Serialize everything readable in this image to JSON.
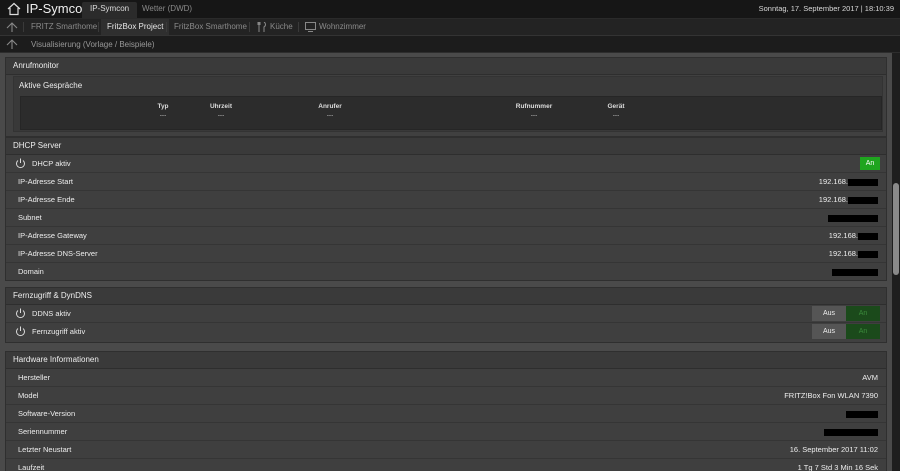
{
  "header": {
    "brand": "IP-Symcon",
    "tabs": [
      {
        "label": "IP-Symcon",
        "active": true
      },
      {
        "label": "Wetter (DWD)",
        "active": false
      }
    ],
    "datetime": "Sonntag, 17. September 2017 | 18:10:39"
  },
  "nav": {
    "items": [
      {
        "label": "FRITZ Smarthome",
        "active": false
      },
      {
        "label": "FritzBox Project",
        "active": true
      },
      {
        "label": "FritzBox Smarthome",
        "active": false
      },
      {
        "label": "Küche",
        "active": false
      },
      {
        "label": "Wohnzimmer",
        "active": false
      }
    ]
  },
  "subnav": {
    "label": "Visualisierung (Vorlage / Beispiele)"
  },
  "anrufmonitor": {
    "title": "Anrufmonitor",
    "subtitle": "Aktive Gespräche",
    "columns": [
      {
        "header": "Typ",
        "value": "---"
      },
      {
        "header": "Uhrzeit",
        "value": "---"
      },
      {
        "header": "Anrufer",
        "value": "---"
      },
      {
        "header": "Rufnummer",
        "value": "---"
      },
      {
        "header": "Gerät",
        "value": "---"
      }
    ]
  },
  "dhcp": {
    "title": "DHCP Server",
    "aktiv_label": "DHCP aktiv",
    "aktiv_button": "An",
    "rows": [
      {
        "label": "IP-Adresse Start",
        "value": "192.168."
      },
      {
        "label": "IP-Adresse Ende",
        "value": "192.168."
      },
      {
        "label": "Subnet",
        "value": ""
      },
      {
        "label": "IP-Adresse Gateway",
        "value": "192.168."
      },
      {
        "label": "IP-Adresse DNS-Server",
        "value": "192.168."
      },
      {
        "label": "Domain",
        "value": ""
      }
    ]
  },
  "fernzugriff": {
    "title": "Fernzugriff & DynDNS",
    "rows": [
      {
        "label": "DDNS aktiv",
        "off": "Aus",
        "on": "An"
      },
      {
        "label": "Fernzugriff aktiv",
        "off": "Aus",
        "on": "An"
      }
    ]
  },
  "hardware": {
    "title": "Hardware Informationen",
    "rows": [
      {
        "label": "Hersteller",
        "value": "AVM"
      },
      {
        "label": "Model",
        "value": "FRITZ!Box Fon WLAN 7390"
      },
      {
        "label": "Software-Version",
        "value": ""
      },
      {
        "label": "Seriennummer",
        "value": ""
      },
      {
        "label": "Letzter Neustart",
        "value": "16. September 2017 11:02"
      },
      {
        "label": "Laufzeit",
        "value": "1 Tg 7 Std 3 Min 16 Sek"
      }
    ]
  },
  "icons": {
    "home": "home-icon",
    "up": "up-arrow-icon",
    "power": "power-icon",
    "kitchen": "fork-knife-icon",
    "tv": "tv-icon"
  }
}
